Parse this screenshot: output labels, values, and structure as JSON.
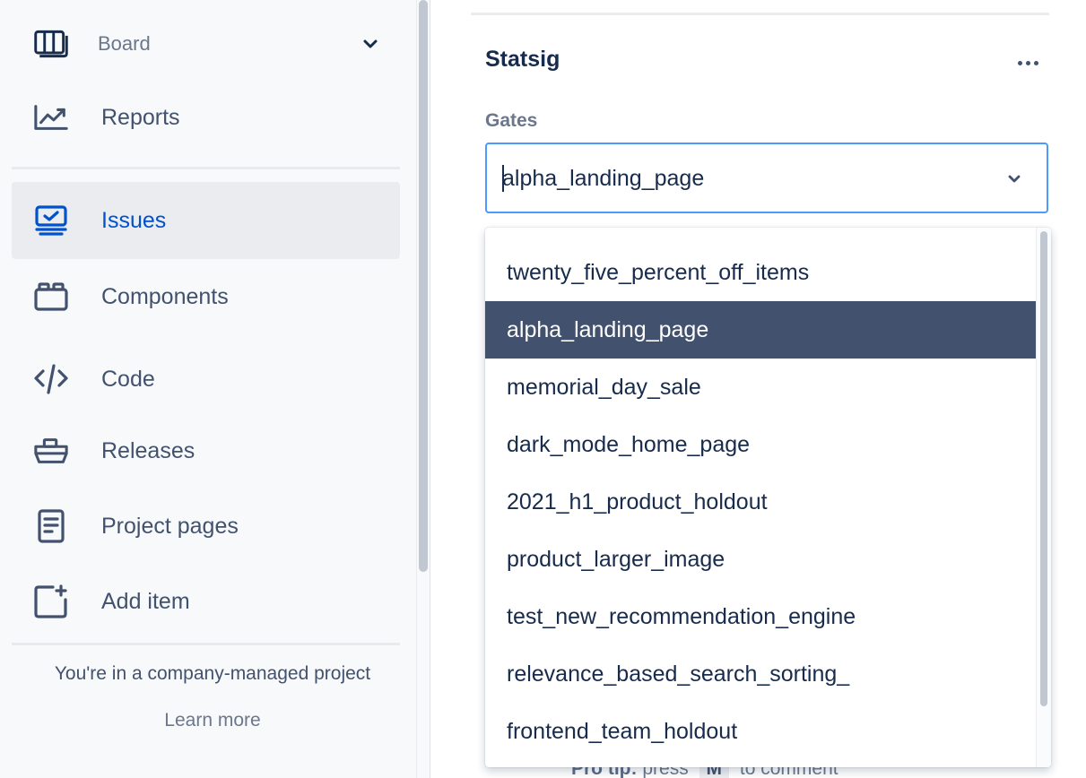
{
  "sidebar": {
    "board_label": "Board",
    "items": [
      {
        "label": "Reports",
        "icon": "reports-chart-icon"
      },
      {
        "label": "Issues",
        "icon": "issues-icon",
        "active": true
      },
      {
        "label": "Components",
        "icon": "components-icon"
      },
      {
        "label": "Code",
        "icon": "code-icon"
      },
      {
        "label": "Releases",
        "icon": "releases-ship-icon"
      },
      {
        "label": "Project pages",
        "icon": "project-pages-icon"
      },
      {
        "label": "Add item",
        "icon": "add-item-icon"
      }
    ],
    "footer_text": "You're in a company-managed project",
    "learn_more": "Learn more"
  },
  "panel": {
    "title": "Statsig",
    "field_label": "Gates",
    "select_value": "alpha_landing_page",
    "options": [
      "twenty_five_percent_off_items",
      "alpha_landing_page",
      "memorial_day_sale",
      "dark_mode_home_page",
      "2021_h1_product_holdout",
      "product_larger_image",
      "test_new_recommendation_engine",
      "relevance_based_search_sorting_",
      "frontend_team_holdout"
    ],
    "selected_option": "alpha_landing_page",
    "protip": {
      "prefix": "Pro tip:",
      "text": "press",
      "key": "M",
      "suffix": "to comment"
    }
  },
  "colors": {
    "accent": "#0052cc",
    "focus_border": "#4c9aff",
    "selected_bg": "#42526e",
    "sidebar_bg": "#f8f9fb"
  }
}
